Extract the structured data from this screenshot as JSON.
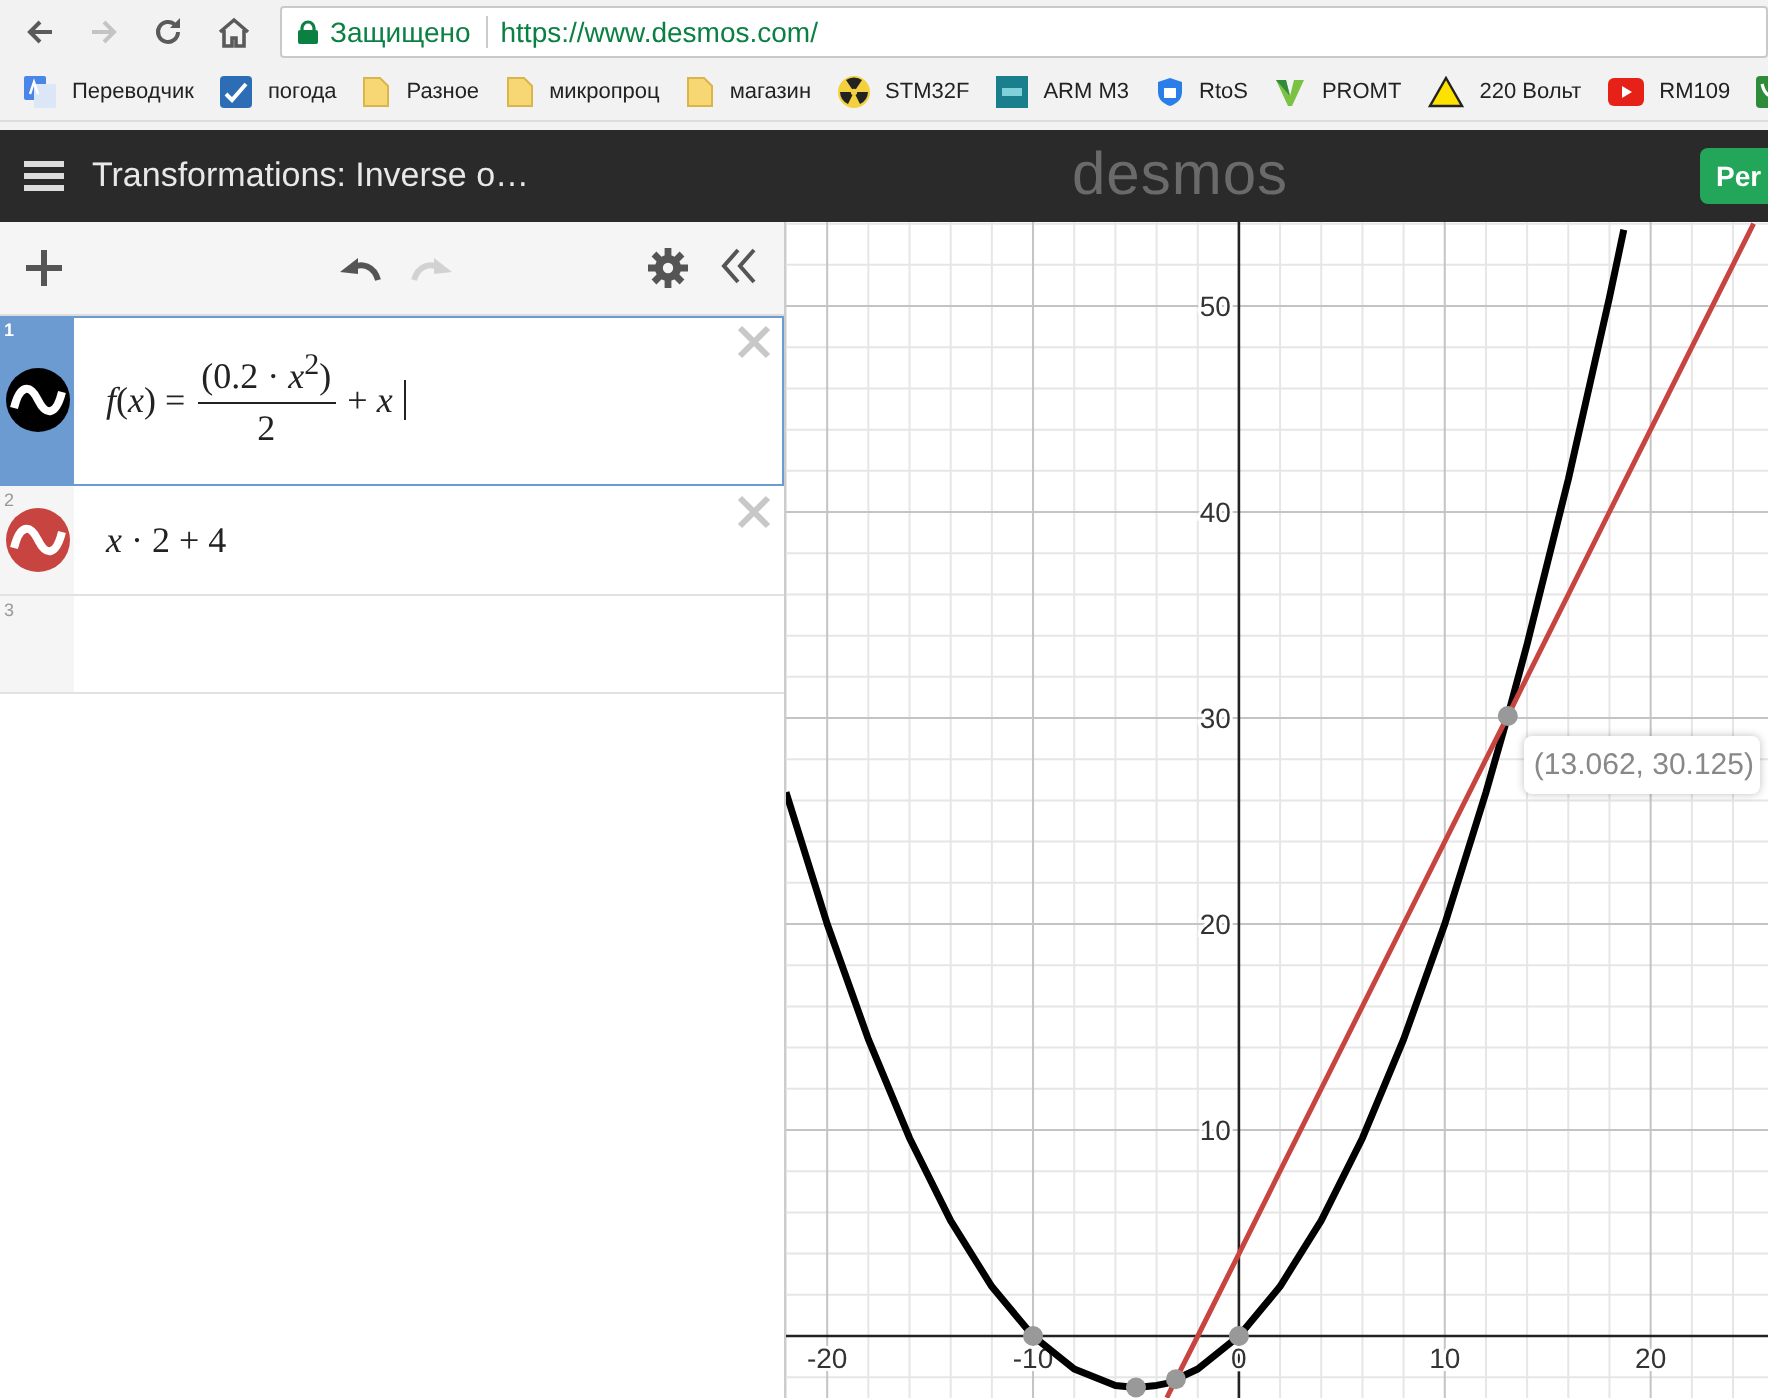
{
  "browser": {
    "nav": [
      {
        "kind": "back",
        "disabled": false
      },
      {
        "kind": "forward",
        "disabled": true
      },
      {
        "kind": "reload",
        "disabled": false
      },
      {
        "kind": "home",
        "disabled": false
      }
    ],
    "security": "Защищено",
    "url": "https://www.desmos.com/"
  },
  "bookmarks": [
    {
      "kind": "translate",
      "label": "Переводчик"
    },
    {
      "kind": "weather",
      "label": "погода"
    },
    {
      "kind": "folder",
      "label": "Разное"
    },
    {
      "kind": "folder",
      "label": "микропроц"
    },
    {
      "kind": "folder",
      "label": "магазин"
    },
    {
      "kind": "radiation",
      "label": "STM32F"
    },
    {
      "kind": "arm",
      "label": "ARM M3"
    },
    {
      "kind": "shield",
      "label": "RtoS"
    },
    {
      "kind": "promt",
      "label": "PROMT"
    },
    {
      "kind": "warning",
      "label": "220 Вольт"
    },
    {
      "kind": "video",
      "label": "RM109"
    },
    {
      "kind": "leaf"
    }
  ],
  "header": {
    "title": "Transformations: Inverse o…",
    "logo": "desmos",
    "button": "Per"
  },
  "toolbar": [
    {
      "kind": "add",
      "disabled": false
    },
    {
      "kind": "undo",
      "disabled": false
    },
    {
      "kind": "redo",
      "disabled": true
    },
    {
      "kind": "settings",
      "disabled": false
    },
    {
      "kind": "collapse",
      "disabled": false
    }
  ],
  "expressions": [
    {
      "number": "1",
      "selected": true,
      "color": "#000000",
      "kind": "fraction",
      "lhs": "*f*(*x*) =",
      "numerator": "(0.2 · *x*$^{2}$)",
      "denominator": "2",
      "rest": "+ *x*"
    },
    {
      "number": "2",
      "selected": false,
      "color": "#c74440",
      "kind": "plain",
      "text": "*x* · 2 + 4"
    },
    {
      "number": "3",
      "selected": false,
      "kind": "empty"
    }
  ],
  "graph": {
    "chart_data": {
      "type": "line",
      "grid": true,
      "x": [
        -22,
        -20,
        -18,
        -16,
        -14,
        -12,
        -10,
        -8,
        -6,
        -5,
        -4,
        -3.5,
        -3.06,
        -2,
        0,
        2,
        4,
        6,
        8,
        10,
        12,
        13.062,
        14,
        16,
        18,
        18.7,
        20,
        22,
        24,
        25
      ],
      "series": [
        {
          "color": "#000000",
          "values": [
            26.4,
            20,
            14.4,
            9.6,
            5.6,
            2.4,
            0,
            -1.6,
            -2.4,
            -2.5,
            -2.4,
            -2.3,
            -2.1,
            -1.6,
            0,
            2.4,
            5.6,
            9.6,
            14.4,
            20,
            26.4,
            30.1,
            33.6,
            41.6,
            50.4,
            53.7,
            null,
            null,
            null,
            null
          ]
        },
        {
          "color": "#c74440",
          "values": [
            null,
            null,
            null,
            null,
            null,
            null,
            null,
            null,
            null,
            null,
            null,
            -3,
            -2.1,
            0,
            4,
            8,
            12,
            16,
            20,
            24,
            28,
            30.1,
            32,
            36,
            40,
            41.4,
            44,
            48,
            52,
            54
          ]
        },
        {
          "type": "scatter",
          "color": "#999999",
          "values": [
            null,
            null,
            null,
            null,
            null,
            null,
            0,
            null,
            null,
            -2.5,
            null,
            null,
            -2.1,
            null,
            0,
            null,
            null,
            null,
            null,
            null,
            null,
            30.1,
            null,
            null,
            null,
            null,
            null,
            null,
            null,
            null
          ]
        }
      ],
      "xlim": [
        -22,
        25.7
      ],
      "ylim": [
        -3.01,
        54.08
      ],
      "xticks": [
        -20,
        -10,
        0,
        10,
        20
      ],
      "yticks": [
        10,
        20,
        30,
        40,
        50
      ],
      "annotations": [
        {
          "x": 13.062,
          "y": 30.125,
          "text": "(13.062, 30.125)"
        }
      ]
    }
  }
}
